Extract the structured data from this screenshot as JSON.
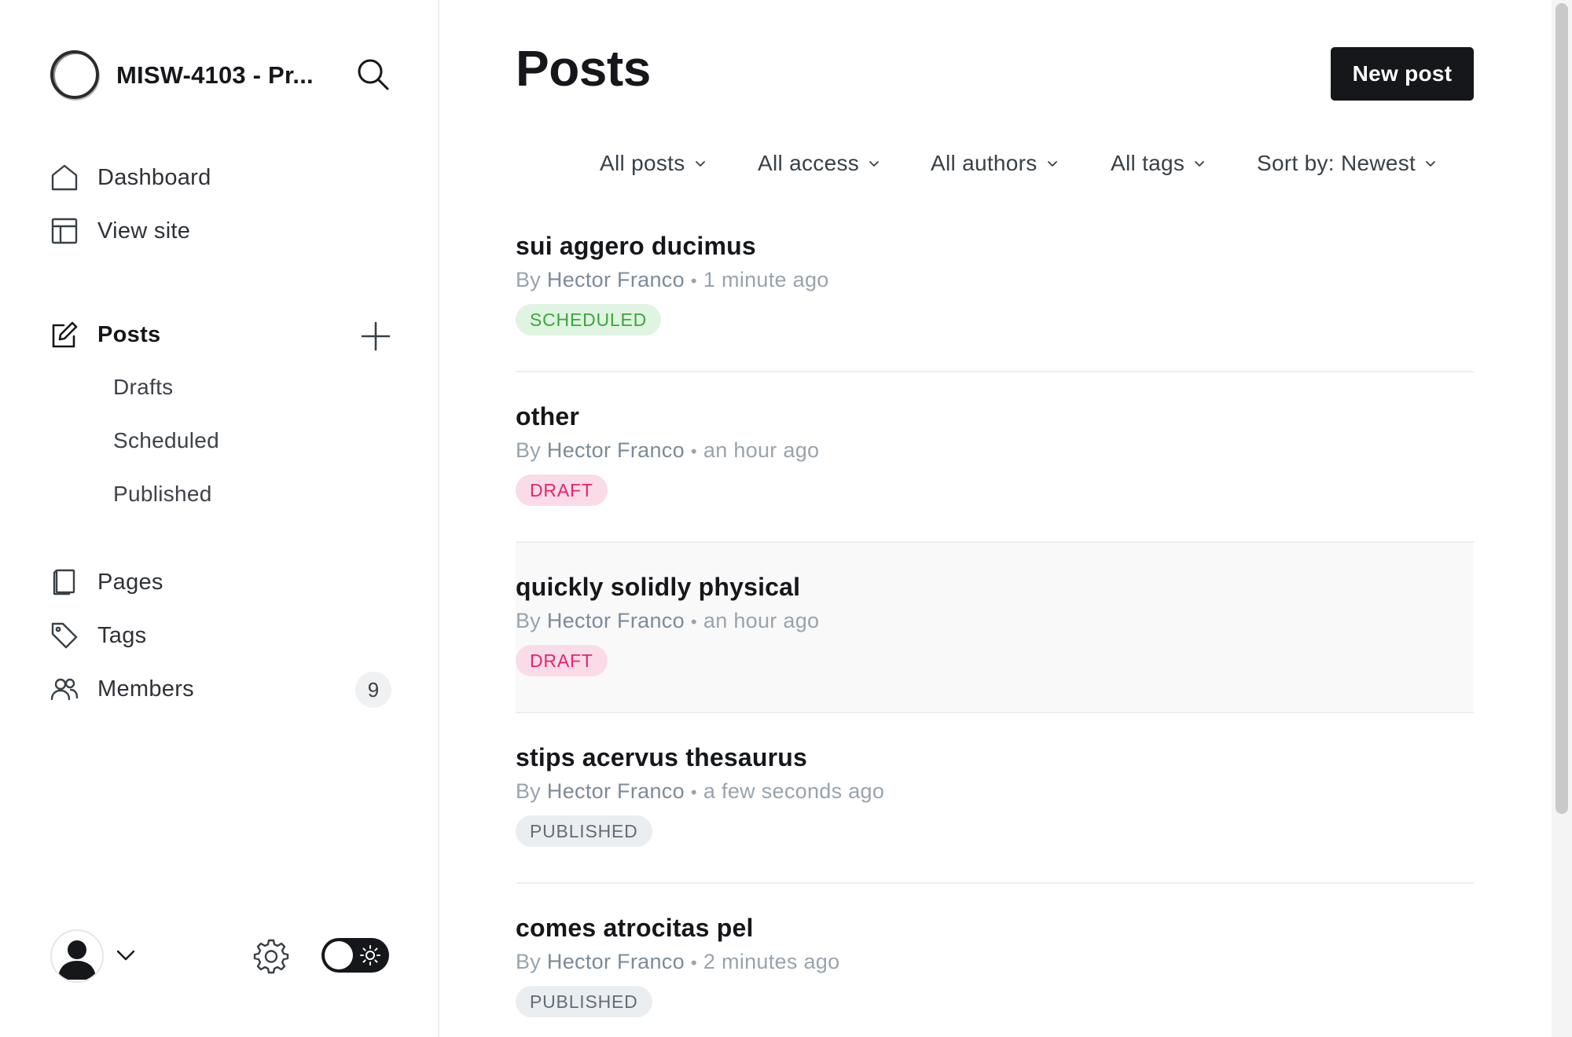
{
  "sidebar": {
    "site_title": "MISW-4103 - Pr...",
    "nav_primary": [
      {
        "label": "Dashboard",
        "icon": "home-icon"
      },
      {
        "label": "View site",
        "icon": "layout-icon"
      }
    ],
    "posts": {
      "label": "Posts",
      "subitems": [
        {
          "label": "Drafts"
        },
        {
          "label": "Scheduled"
        },
        {
          "label": "Published"
        }
      ]
    },
    "nav_secondary": [
      {
        "label": "Pages",
        "icon": "page-icon"
      },
      {
        "label": "Tags",
        "icon": "tag-icon"
      },
      {
        "label": "Members",
        "icon": "members-icon",
        "count": "9"
      }
    ]
  },
  "main": {
    "title": "Posts",
    "new_post_label": "New post",
    "filters": [
      {
        "label": "All posts"
      },
      {
        "label": "All access"
      },
      {
        "label": "All authors"
      },
      {
        "label": "All tags"
      },
      {
        "label": "Sort by: Newest"
      }
    ],
    "posts": [
      {
        "title": "sui aggero ducimus",
        "by": "By",
        "author": "Hector Franco",
        "time": "1 minute ago",
        "status": "SCHEDULED"
      },
      {
        "title": "other",
        "by": "By",
        "author": "Hector Franco",
        "time": "an hour ago",
        "status": "DRAFT"
      },
      {
        "title": "quickly solidly physical",
        "by": "By",
        "author": "Hector Franco",
        "time": "an hour ago",
        "status": "DRAFT"
      },
      {
        "title": "stips acervus thesaurus",
        "by": "By",
        "author": "Hector Franco",
        "time": "a few seconds ago",
        "status": "PUBLISHED"
      },
      {
        "title": "comes atrocitas pel",
        "by": "By",
        "author": "Hector Franco",
        "time": "2 minutes ago",
        "status": "PUBLISHED"
      }
    ]
  },
  "colors": {
    "scheduled_text": "#3da63d",
    "scheduled_bg": "#dff4e1",
    "draft_text": "#e2266e",
    "draft_bg": "#fadbe8",
    "published_text": "#626d79",
    "published_bg": "#ebeef0",
    "primary_button": "#15171a"
  }
}
